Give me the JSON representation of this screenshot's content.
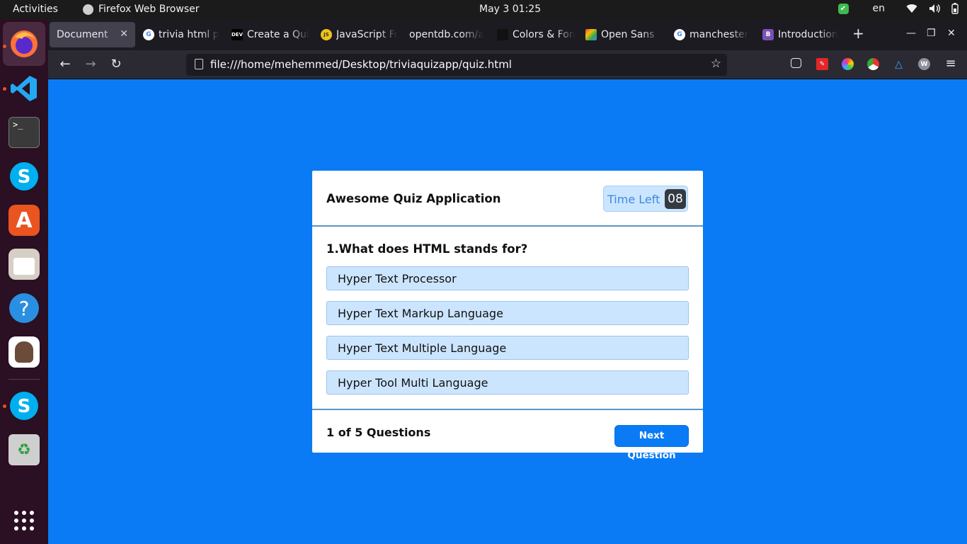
{
  "topbar": {
    "activities": "Activities",
    "app_name": "Firefox Web Browser",
    "clock": "May 3  01:25",
    "language": "en"
  },
  "browser": {
    "tabs": [
      {
        "label": "Document",
        "icon": "page-icon",
        "active": true
      },
      {
        "label": "trivia html p",
        "icon": "google-icon"
      },
      {
        "label": "Create a Qui",
        "icon": "dev-icon",
        "icon_text": "DEV"
      },
      {
        "label": "JavaScript Fr",
        "icon": "js-icon",
        "icon_text": "JS"
      },
      {
        "label": "opentdb.com/a",
        "icon": "none"
      },
      {
        "label": "Colors & Fon",
        "icon": "colors-icon"
      },
      {
        "label": "Open Sans -",
        "icon": "font-icon"
      },
      {
        "label": "manchester",
        "icon": "google-icon"
      },
      {
        "label": "Introduction",
        "icon": "bootstrap-icon",
        "icon_text": "B"
      }
    ],
    "url": "file:///home/mehemmed/Desktop/triviaquizapp/quiz.html"
  },
  "quiz": {
    "title": "Awesome Quiz Application",
    "timer_label": "Time Left",
    "timer_seconds": "08",
    "question": "1.What does HTML stands for?",
    "options": [
      "Hyper Text Processor",
      "Hyper Text Markup Language",
      "Hyper Text Multiple Language",
      "Hyper Tool Multi Language"
    ],
    "question_count": "1 of 5 Questions",
    "next_label": "Next Question"
  },
  "colors": {
    "page_background": "#0a7bf4",
    "option_background": "#cce5ff",
    "timer_badge": "#343a40"
  }
}
